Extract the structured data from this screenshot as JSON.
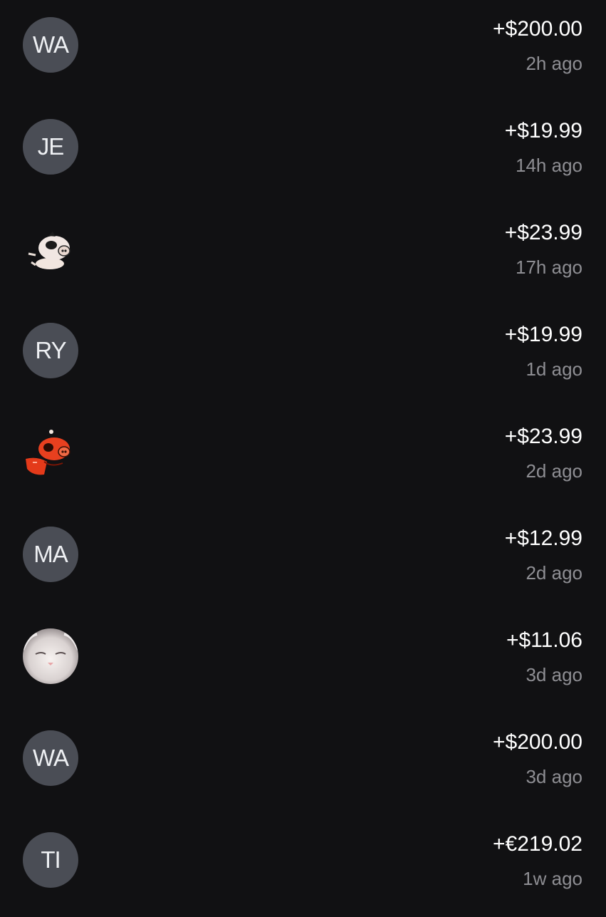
{
  "transactions": [
    {
      "avatar_initials": "WA",
      "amount": "+$200.00",
      "time": "2h ago"
    },
    {
      "avatar_initials": "JE",
      "amount": "+$19.99",
      "time": "14h ago"
    },
    {
      "avatar_icon": "cartoon-pig-avatar-white",
      "amount": "+$23.99",
      "time": "17h ago"
    },
    {
      "avatar_initials": "RY",
      "amount": "+$19.99",
      "time": "1d ago"
    },
    {
      "avatar_icon": "cartoon-pig-avatar-red",
      "amount": "+$23.99",
      "time": "2d ago"
    },
    {
      "avatar_initials": "MA",
      "amount": "+$12.99",
      "time": "2d ago"
    },
    {
      "avatar_icon": "white-cat-photo-avatar",
      "amount": "+$11.06",
      "time": "3d ago"
    },
    {
      "avatar_initials": "WA",
      "amount": "+$200.00",
      "time": "3d ago"
    },
    {
      "avatar_initials": "TI",
      "amount": "+€219.02",
      "time": "1w ago"
    }
  ],
  "colors": {
    "background": "#111113",
    "avatar_background": "#4a4d55",
    "amount_text": "#ffffff",
    "time_text": "#8e8e93"
  }
}
